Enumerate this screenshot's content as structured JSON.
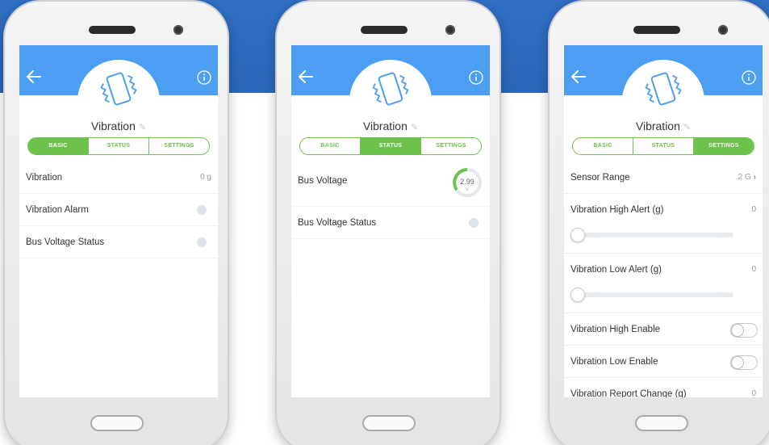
{
  "phones": [
    {
      "device_name": "Vibration",
      "tabs": [
        "BASIC",
        "STATUS",
        "SETTINGS"
      ],
      "active_tab": "BASIC",
      "rows": [
        {
          "label": "Vibration",
          "value": "0 g"
        },
        {
          "label": "Vibration Alarm"
        },
        {
          "label": "Bus Voltage Status"
        }
      ]
    },
    {
      "device_name": "Vibration",
      "tabs": [
        "BASIC",
        "STATUS",
        "SETTINGS"
      ],
      "active_tab": "STATUS",
      "rows": [
        {
          "label": "Bus Voltage",
          "gauge_value": "2.99",
          "gauge_unit": "V"
        },
        {
          "label": "Bus Voltage Status"
        }
      ]
    },
    {
      "device_name": "Vibration",
      "tabs": [
        "BASIC",
        "STATUS",
        "SETTINGS"
      ],
      "active_tab": "SETTINGS",
      "rows": [
        {
          "label": "Sensor Range",
          "value": "2 G"
        },
        {
          "label": "Vibration High Alert (g)",
          "value": "0",
          "slider_level": 0
        },
        {
          "label": "Vibration Low Alert (g)",
          "value": "0",
          "slider_level": 0
        },
        {
          "label": "Vibration High Enable",
          "toggle_on": false
        },
        {
          "label": "Vibration Low Enable",
          "toggle_on": false
        },
        {
          "label": "Vibration Report Change (g)",
          "value": "0"
        }
      ]
    }
  ],
  "colors": {
    "app_bar": "#4b9ef2",
    "accent_green": "#6cc24a",
    "background_blue": "#2f6fc4"
  },
  "icons": {
    "back": "arrow-left-icon",
    "info": "info-icon",
    "device": "vibration-phone-icon",
    "edit": "pencil-icon",
    "chevron": "chevron-right-icon"
  }
}
